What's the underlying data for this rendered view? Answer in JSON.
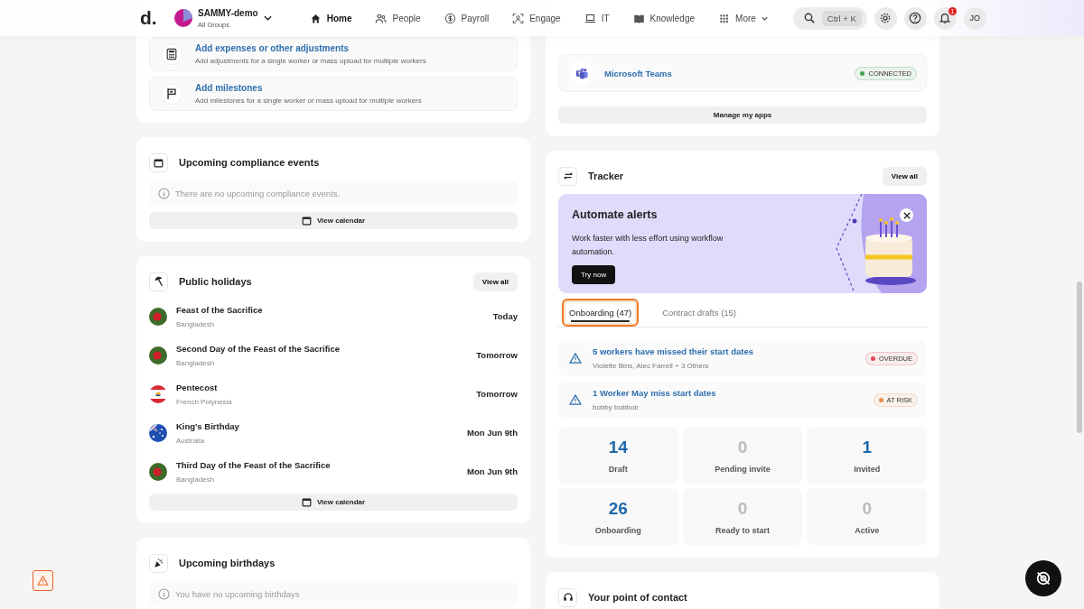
{
  "nav": {
    "logo": "d.",
    "org": {
      "name": "SAMMY-demo",
      "subtitle": "All Groups"
    },
    "items": [
      {
        "label": "Home",
        "selected": true
      },
      {
        "label": "People",
        "selected": false
      },
      {
        "label": "Payroll",
        "selected": false
      },
      {
        "label": "Engage",
        "selected": false
      },
      {
        "label": "IT",
        "selected": false
      },
      {
        "label": "Knowledge",
        "selected": false
      },
      {
        "label": "More",
        "selected": false
      }
    ],
    "search_shortcut": "Ctrl + K",
    "notifications": "1",
    "avatar": "JO"
  },
  "quick_actions": [
    {
      "title": "Add expenses or other adjustments",
      "description": "Add adjustments for a single worker or mass upload for multiple workers"
    },
    {
      "title": "Add milestones",
      "description": "Add milestones for a single worker or mass upload for multiple workers"
    }
  ],
  "compliance": {
    "title": "Upcoming compliance events",
    "empty": "There are no upcoming compliance events.",
    "button": "View calendar"
  },
  "holidays": {
    "title": "Public holidays",
    "view_all": "View all",
    "items": [
      {
        "name": "Feast of the Sacrifice",
        "country": "Bangladesh",
        "kind": "bd",
        "when": "Today"
      },
      {
        "name": "Second Day of the Feast of the Sacrifice",
        "country": "Bangladesh",
        "kind": "bd",
        "when": "Tomorrow"
      },
      {
        "name": "Pentecost",
        "country": "French Polynesia",
        "kind": "pf",
        "when": "Tomorrow"
      },
      {
        "name": "King's Birthday",
        "country": "Australia",
        "kind": "au",
        "when": "Mon Jun 9th"
      },
      {
        "name": "Third Day of the Feast of the Sacrifice",
        "country": "Bangladesh",
        "kind": "bd",
        "when": "Mon Jun 9th"
      }
    ],
    "button": "View calendar"
  },
  "birthdays": {
    "title": "Upcoming birthdays",
    "empty": "You have no upcoming birthdays"
  },
  "apps": {
    "items": [
      {
        "name": "Microsoft Teams",
        "status": "CONNECTED",
        "color": "#3fa34d"
      }
    ],
    "button": "Manage my apps"
  },
  "tracker": {
    "title": "Tracker",
    "view_all": "View all",
    "banner": {
      "title": "Automate alerts",
      "text": "Work faster with less effort using workflow automation.",
      "button": "Try now"
    },
    "tabs": [
      {
        "label": "Onboarding (47)",
        "selected": true
      },
      {
        "label": "Contract drafts (15)",
        "selected": false
      }
    ],
    "alerts": [
      {
        "title": "5 workers have missed their start dates",
        "names": "Violette Bins, Alec Farrell + 3 Others",
        "badge": "OVERDUE",
        "color": "#e0474c"
      },
      {
        "title": "1 Worker May miss start dates",
        "names": "bobby bobbob",
        "badge": "AT RISK",
        "color": "#ef8a3e"
      }
    ],
    "stats": [
      {
        "value": "14",
        "label": "Draft",
        "muted": false
      },
      {
        "value": "0",
        "label": "Pending invite",
        "muted": true
      },
      {
        "value": "1",
        "label": "Invited",
        "muted": false
      },
      {
        "value": "26",
        "label": "Onboarding",
        "muted": false
      },
      {
        "value": "0",
        "label": "Ready to start",
        "muted": true
      },
      {
        "value": "0",
        "label": "Active",
        "muted": true
      }
    ]
  },
  "contact": {
    "title": "Your point of contact"
  }
}
